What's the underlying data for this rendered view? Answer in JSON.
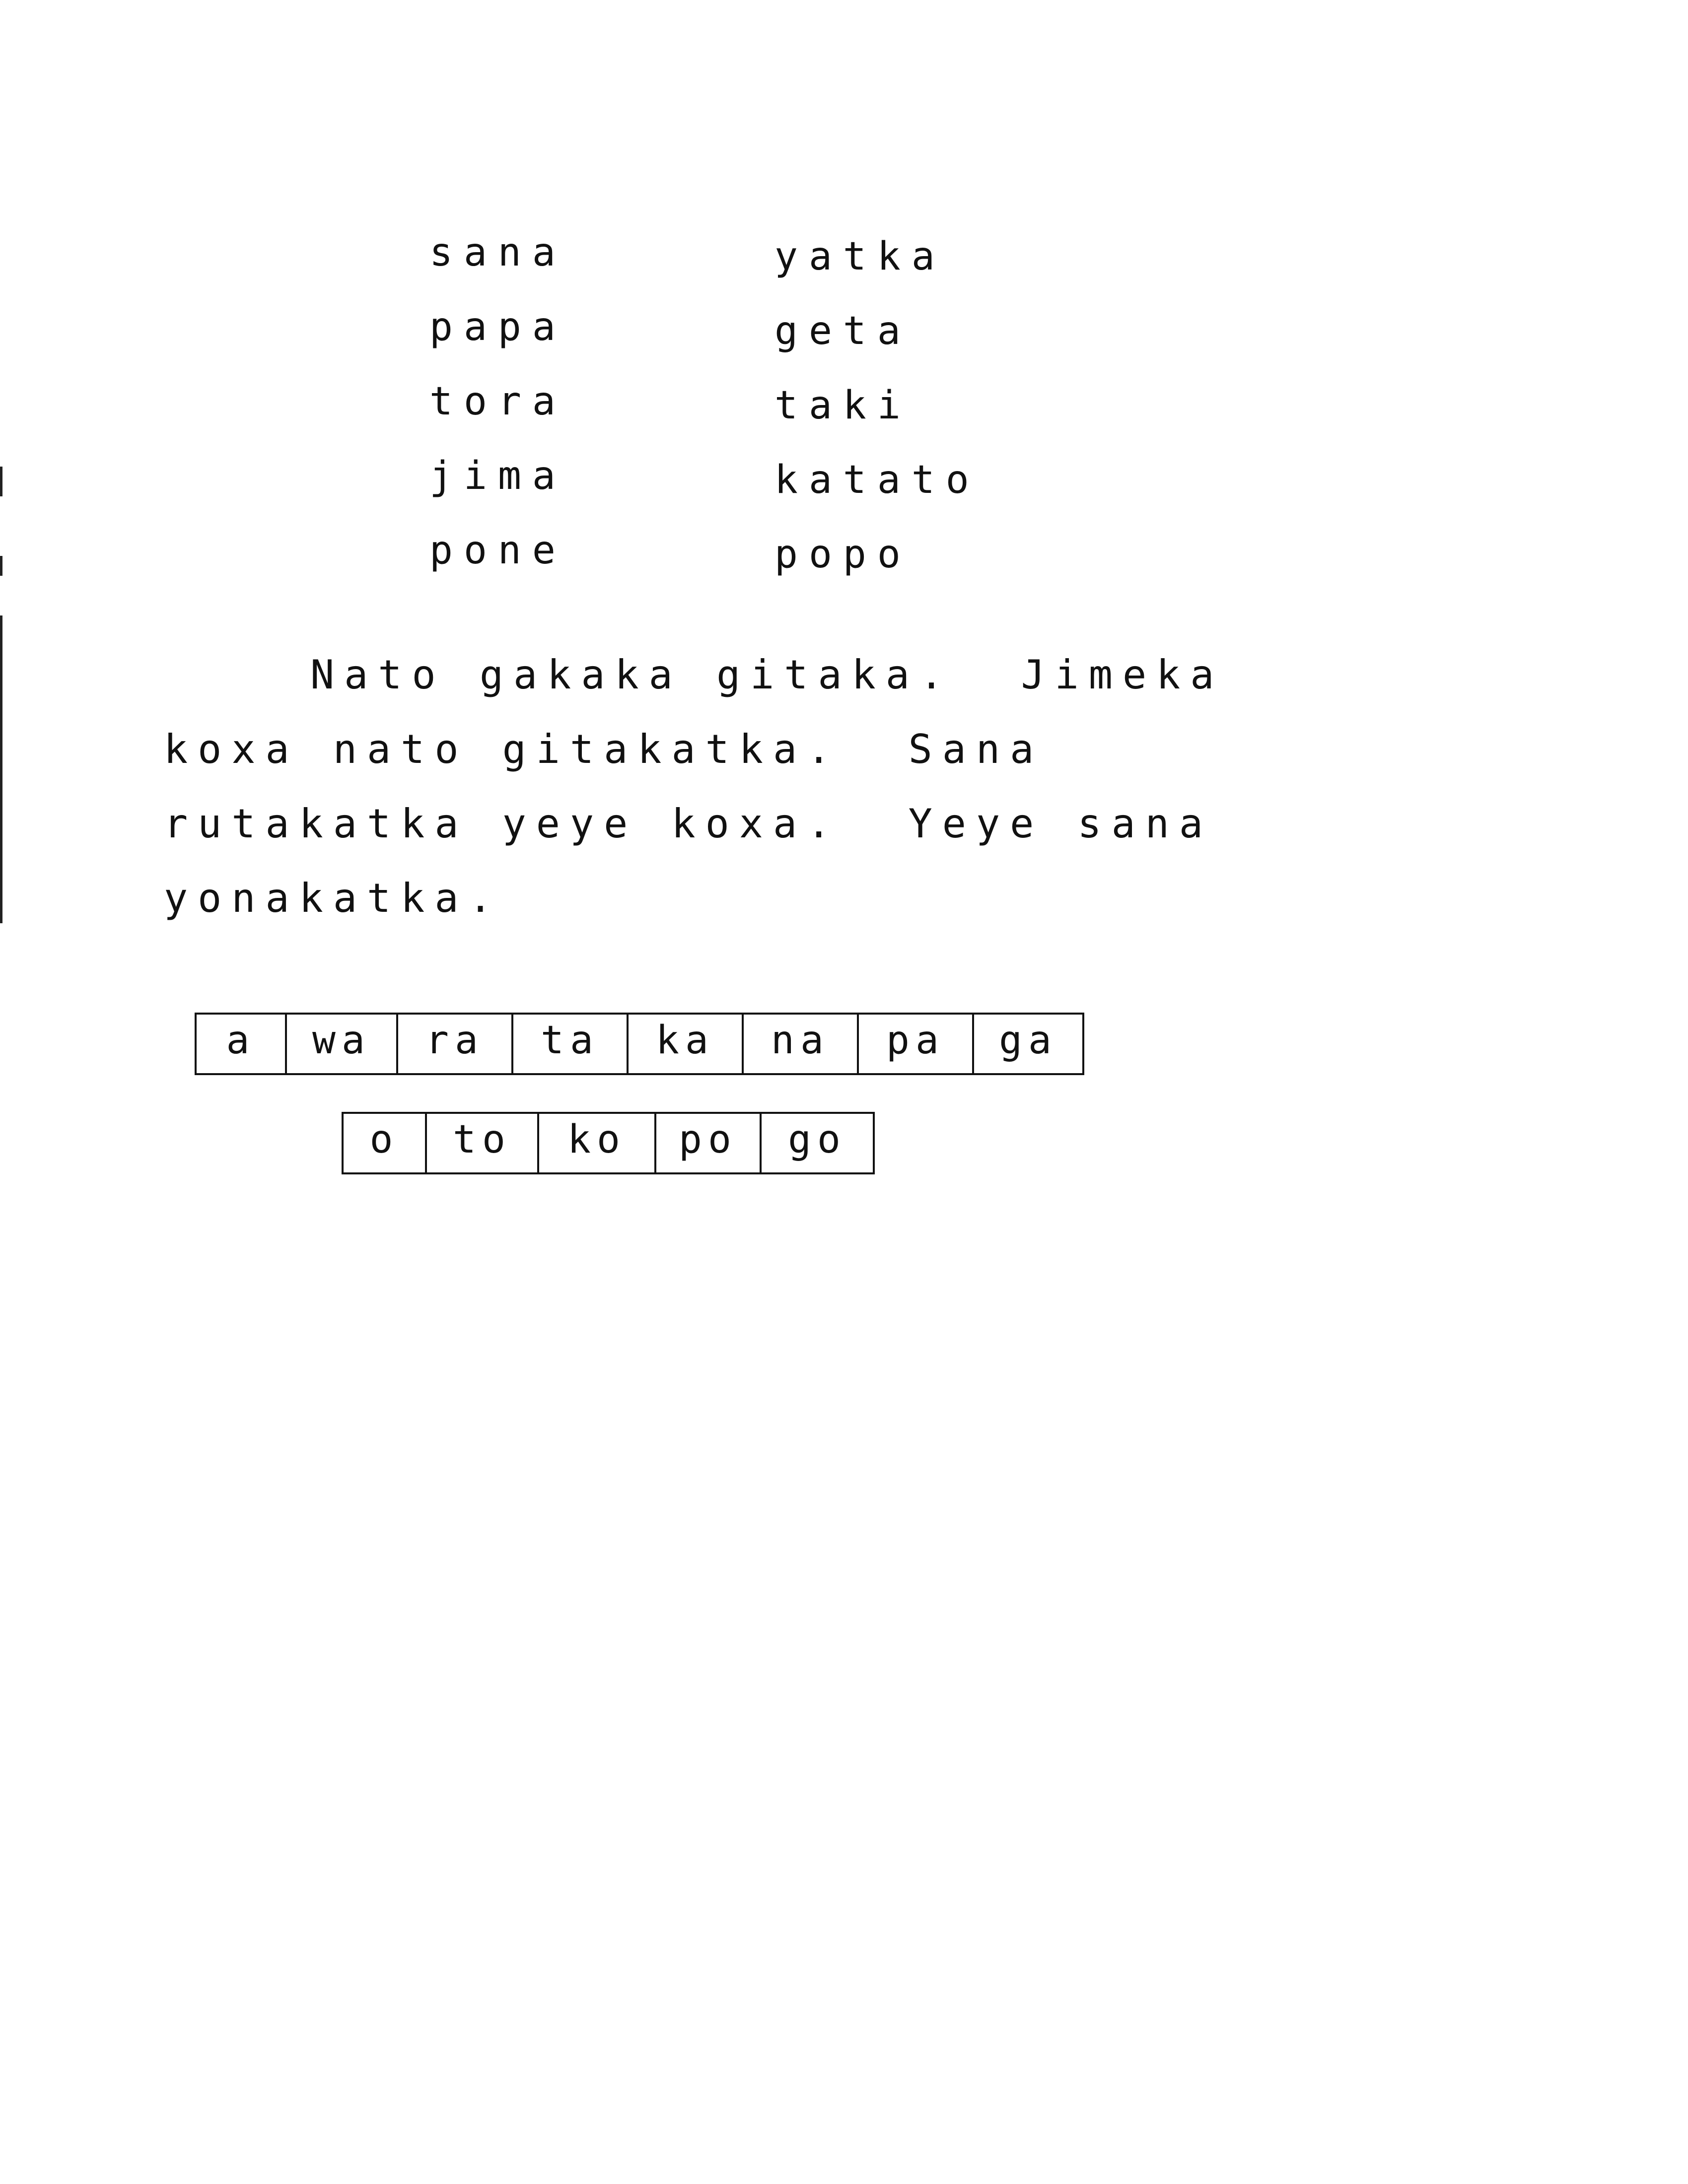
{
  "word_list": {
    "left_column": [
      "sana",
      "papa",
      "tora",
      "jima",
      "pone"
    ],
    "right_column": [
      "yatka",
      "geta",
      "taki",
      "katato",
      "popo"
    ]
  },
  "paragraph": {
    "lines": [
      "Nato gakaka gitaka.  Jimeka",
      "koxa nato gitakatka.  Sana",
      "rutakatka yeye koxa.  Yeye sana",
      "yonakatka."
    ]
  },
  "syllable_rows": [
    [
      "a",
      "wa",
      "ra",
      "ta",
      "ka",
      "na",
      "pa",
      "ga"
    ],
    [
      "o",
      "to",
      "ko",
      "po",
      "go"
    ]
  ]
}
